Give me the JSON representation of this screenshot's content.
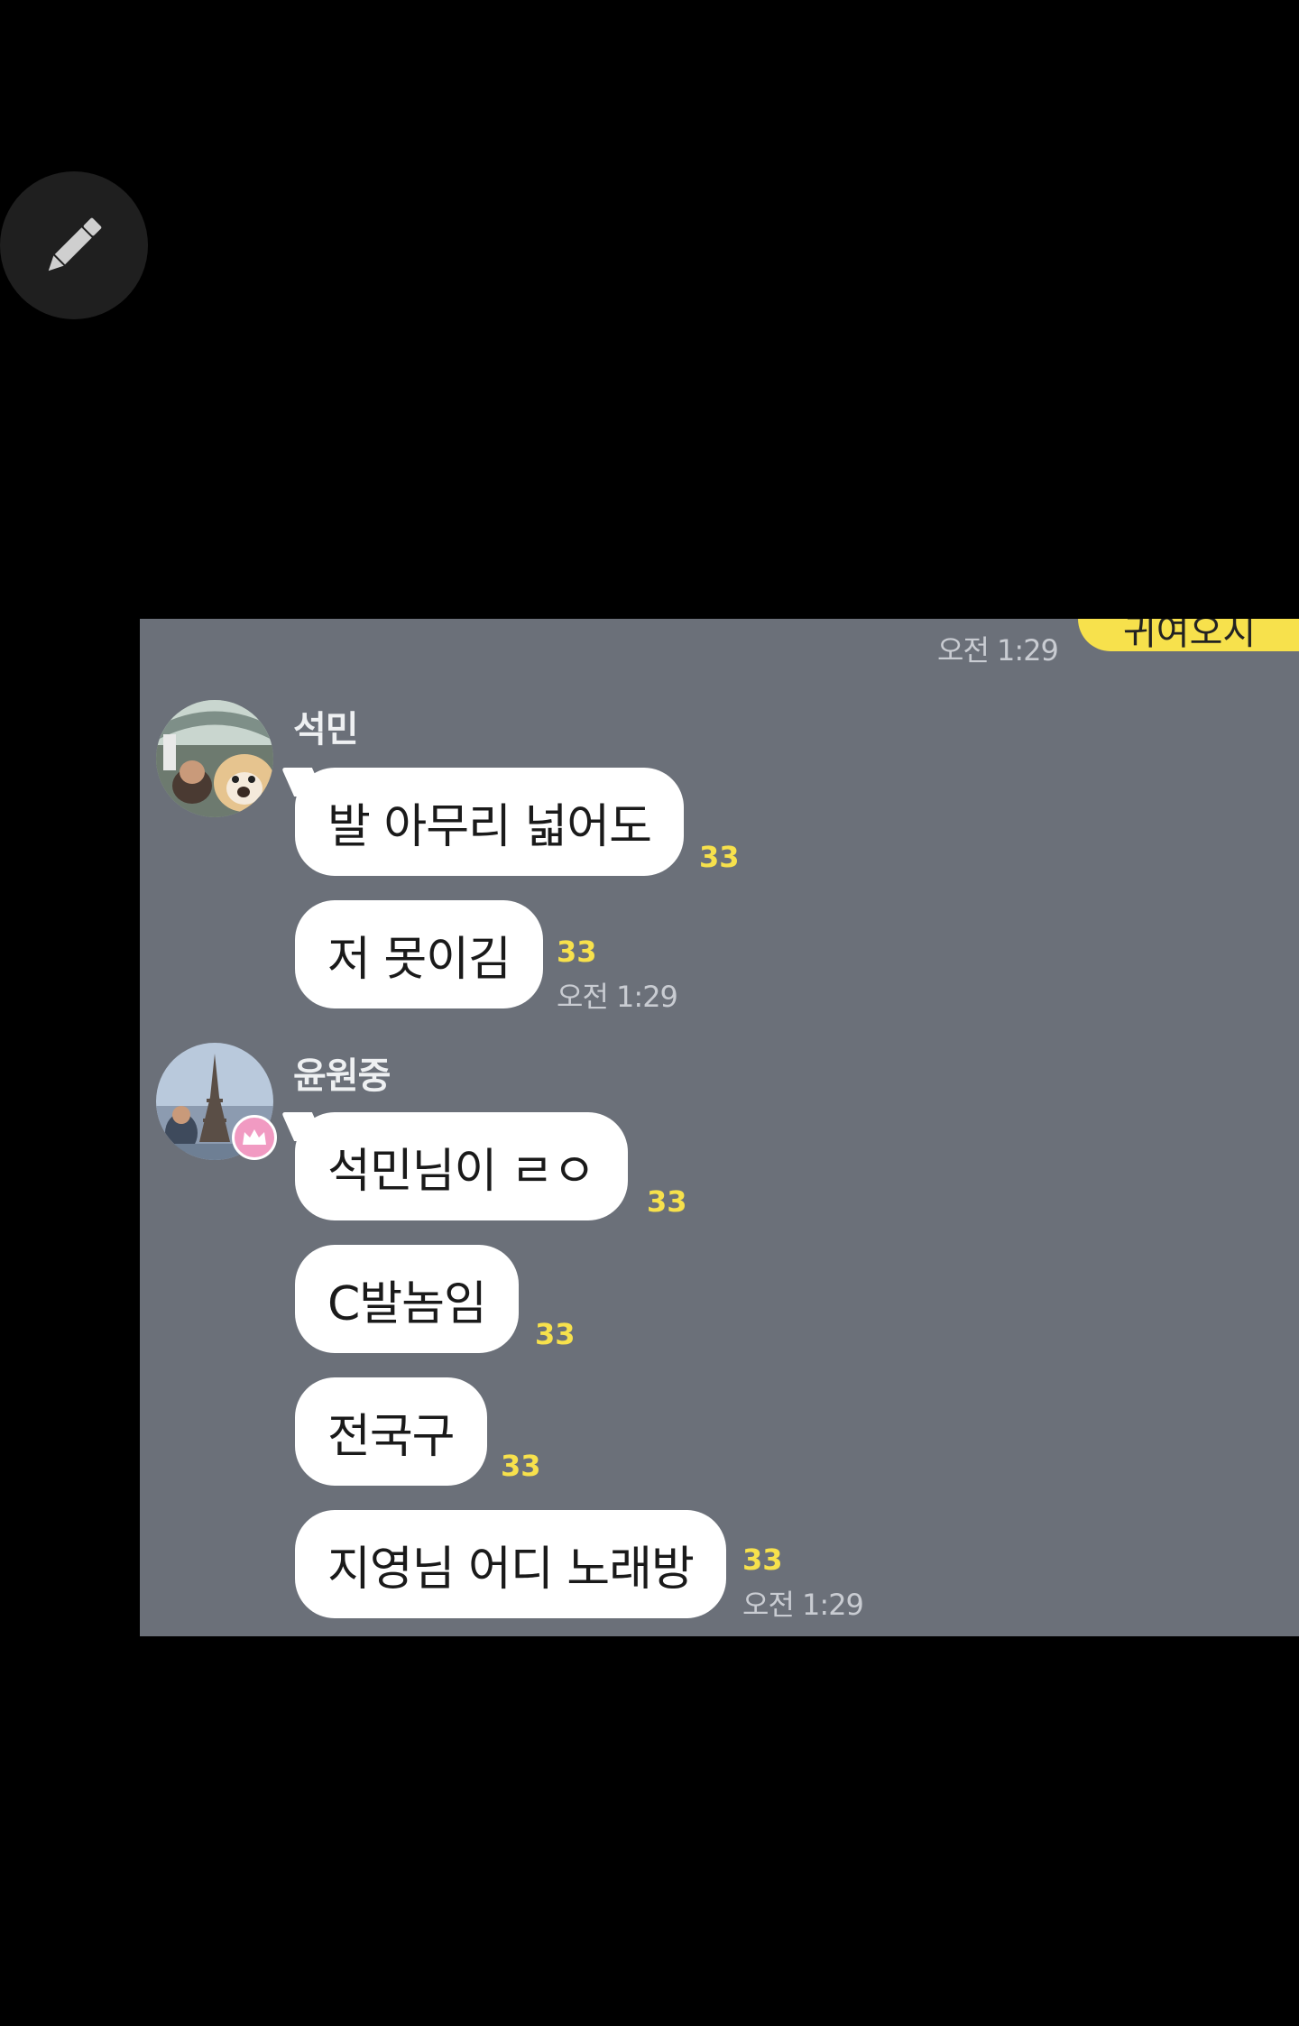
{
  "overlay": {
    "edit_button_icon": "pencil-icon"
  },
  "chat": {
    "background_color": "#6b7079",
    "top": {
      "time": "오전 1:29",
      "my_bubble_text": "귀여오시"
    },
    "groups": [
      {
        "sender": "석민",
        "avatar": "dog-photo-avatar",
        "messages": [
          {
            "text": "발 아무리 넓어도",
            "read_count": "33",
            "time": ""
          },
          {
            "text": "저 못이김",
            "read_count": "33",
            "time": "오전 1:29"
          }
        ]
      },
      {
        "sender": "윤원중",
        "avatar": "eiffel-tower-photo-avatar",
        "badge": "crown-icon",
        "messages": [
          {
            "text": "석민님이 ㄹㅇ",
            "read_count": "33",
            "time": ""
          },
          {
            "text": "C발놈임",
            "read_count": "33",
            "time": ""
          },
          {
            "text": "전국구",
            "read_count": "33",
            "time": ""
          },
          {
            "text": "지영님 어디 노래방",
            "read_count": "33",
            "time": "오전 1:29"
          }
        ]
      }
    ],
    "colors": {
      "my_bubble": "#f7e14c",
      "other_bubble": "#ffffff",
      "read_count": "#f7e14c"
    }
  }
}
